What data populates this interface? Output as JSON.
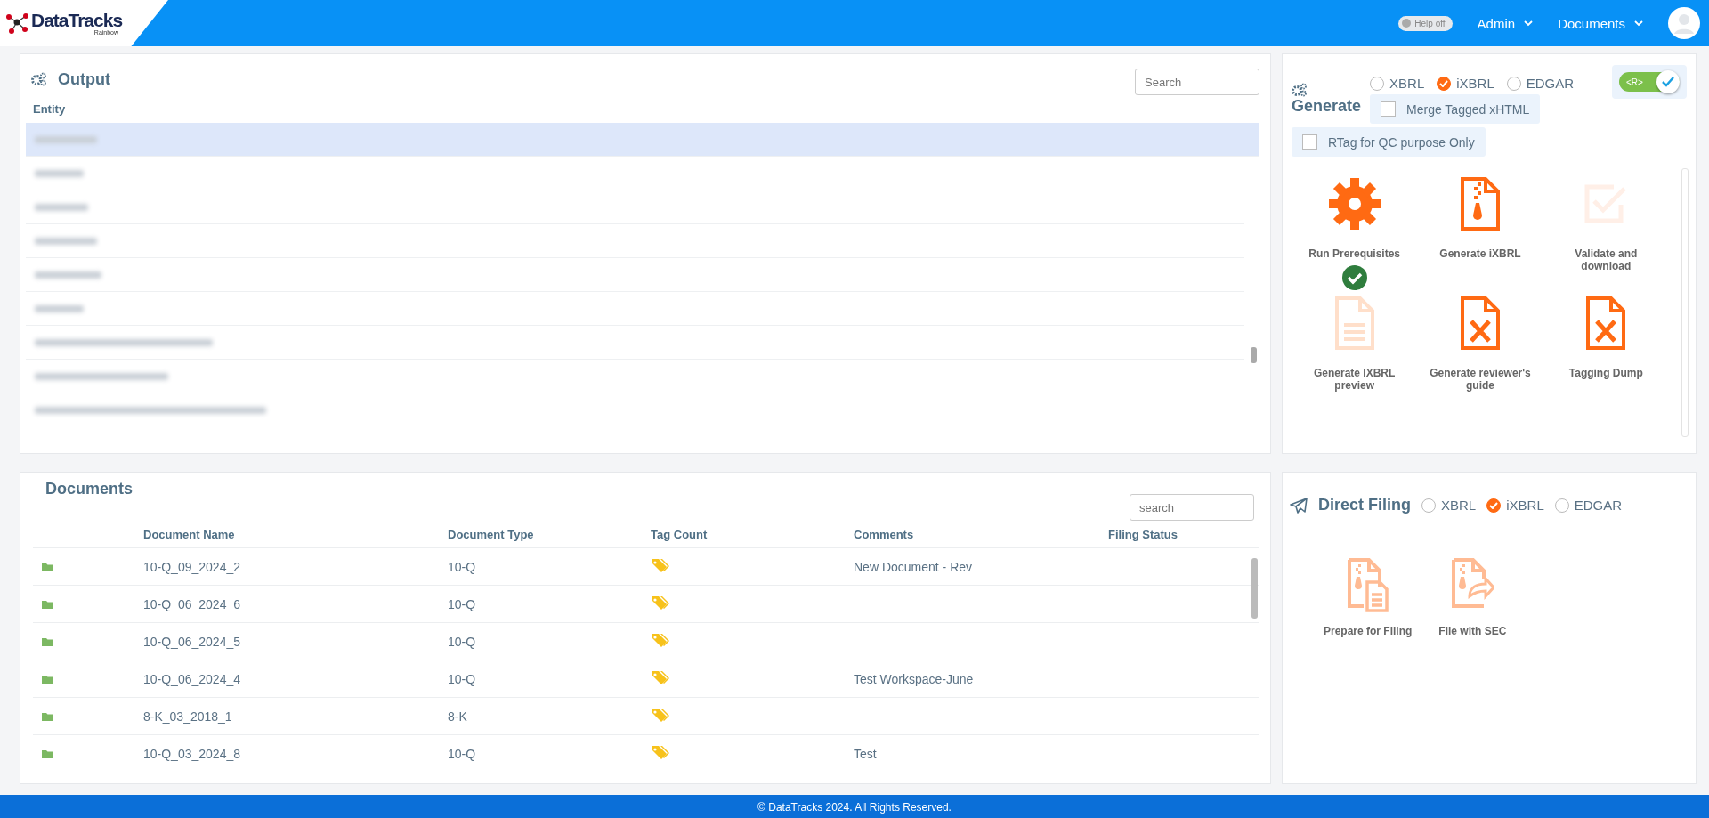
{
  "header": {
    "logo": "DataTracks",
    "logo_sub": "Rainbow",
    "help_toggle": {
      "label": "Help off",
      "on": false
    },
    "menus": [
      "Admin",
      "Documents"
    ]
  },
  "output": {
    "title": "Output",
    "search": {
      "placeholder": "Search"
    },
    "column": "Entity",
    "entity_rows": [
      {
        "selected": true
      },
      {
        "selected": false
      },
      {
        "selected": false
      },
      {
        "selected": false
      },
      {
        "selected": false
      },
      {
        "selected": false
      },
      {
        "selected": false
      },
      {
        "selected": false
      },
      {
        "selected": false
      }
    ]
  },
  "generate": {
    "title": "Generate",
    "formats": [
      {
        "label": "XBRL",
        "selected": false
      },
      {
        "label": "iXBRL",
        "selected": true
      },
      {
        "label": "EDGAR",
        "selected": false
      }
    ],
    "r_toggle": {
      "label": "<R>",
      "on": true
    },
    "options": [
      {
        "label": "Merge Tagged xHTML",
        "checked": false
      },
      {
        "label": "RTag for QC purpose Only",
        "checked": false
      }
    ],
    "actions": [
      {
        "kind": "gear",
        "label": "Run Prerequisites",
        "disabled": false,
        "done": true
      },
      {
        "kind": "zip",
        "label": "Generate iXBRL",
        "disabled": false,
        "done": false
      },
      {
        "kind": "check",
        "label": "Validate and download",
        "disabled": true,
        "done": false
      },
      {
        "kind": "lines",
        "label": "Generate IXBRL preview",
        "disabled": true,
        "done": false
      },
      {
        "kind": "x",
        "label": "Generate reviewer's guide",
        "disabled": false,
        "done": false
      },
      {
        "kind": "x",
        "label": "Tagging Dump",
        "disabled": false,
        "done": false
      }
    ]
  },
  "documents": {
    "title": "Documents",
    "search": {
      "placeholder": "search"
    },
    "columns": [
      "Document Name",
      "Document Type",
      "Tag Count",
      "Comments",
      "Filing Status"
    ],
    "rows": [
      {
        "name": "10-Q_09_2024_2",
        "type": "10-Q",
        "comment": "New Document - Rev"
      },
      {
        "name": "10-Q_06_2024_6",
        "type": "10-Q",
        "comment": ""
      },
      {
        "name": "10-Q_06_2024_5",
        "type": "10-Q",
        "comment": ""
      },
      {
        "name": "10-Q_06_2024_4",
        "type": "10-Q",
        "comment": "Test Workspace-June"
      },
      {
        "name": "8-K_03_2018_1",
        "type": "8-K",
        "comment": ""
      },
      {
        "name": "10-Q_03_2024_8",
        "type": "10-Q",
        "comment": "Test"
      }
    ]
  },
  "direct_filing": {
    "title": "Direct Filing",
    "formats": [
      {
        "label": "XBRL",
        "selected": false
      },
      {
        "label": "iXBRL",
        "selected": true
      },
      {
        "label": "EDGAR",
        "selected": false
      }
    ],
    "actions": [
      {
        "kind": "prepare",
        "label": "Prepare for Filing",
        "disabled": true
      },
      {
        "kind": "send",
        "label": "File with SEC",
        "disabled": true
      }
    ]
  },
  "footer": "© DataTracks 2024. All Rights Reserved."
}
